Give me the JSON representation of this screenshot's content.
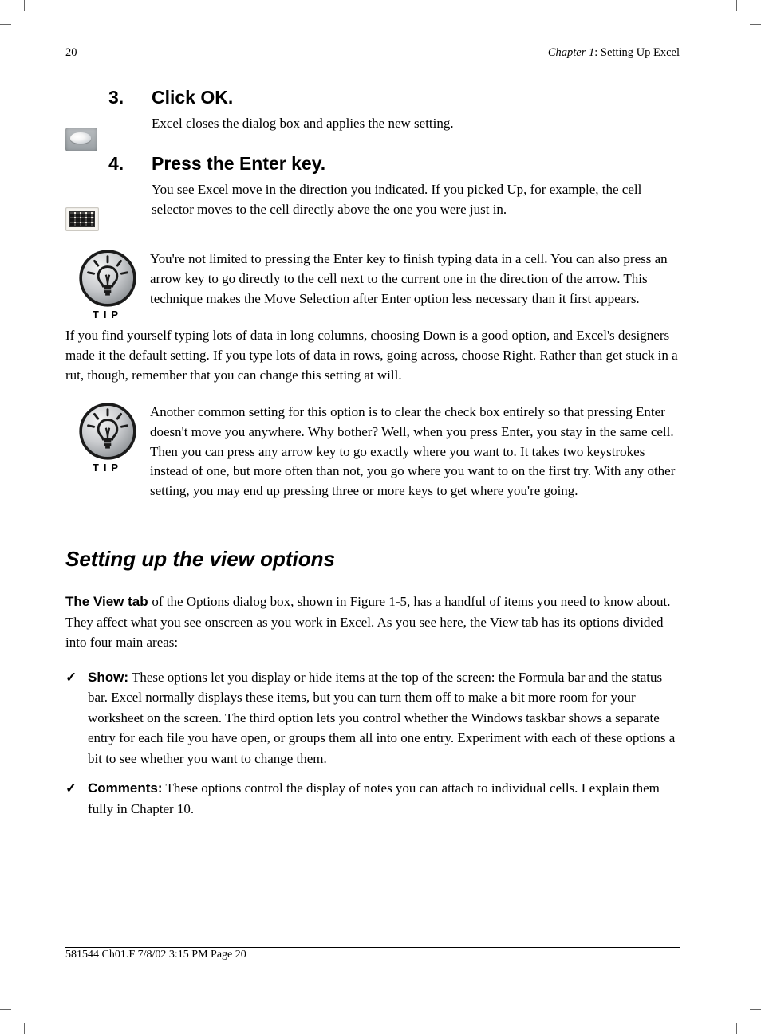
{
  "header": {
    "left": "20",
    "chapter": "Chapter 1",
    "chapter_title": "Setting Up Excel"
  },
  "steps": [
    {
      "num": "3.",
      "title": "Click OK.",
      "text": "Excel closes the dialog box and applies the new setting."
    },
    {
      "num": "4.",
      "title": "Press the Enter key.",
      "text": "You see Excel move in the direction you indicated. If you picked Up, for example, the cell selector moves to the cell directly above the one you were just in."
    }
  ],
  "tips": [
    {
      "label": "TIP",
      "paragraphs": [
        "You're not limited to pressing the Enter key to finish typing data in a cell. You can also press an arrow key to go directly to the cell next to the current one in the direction of the arrow. This technique makes the Move Selection after Enter option less necessary than it first appears."
      ]
    },
    {
      "label": "TIP",
      "paragraphs": [
        "Another common setting for this option is to clear the check box entirely so that pressing Enter doesn't move you anywhere. Why bother? Well, when you press Enter, you stay in the same cell. Then you can press any arrow key to go exactly where you want to. It takes two keystrokes instead of one, but more often than not, you go where you want to on the first try. With any other setting, you may end up pressing three or more keys to get where you're going."
      ]
    }
  ],
  "standalone_para": "If you find yourself typing lots of data in long columns, choosing Down is a good option, and Excel's designers made it the default setting. If you type lots of data in rows, going across, choose Right. Rather than get stuck in a rut, though, remember that you can change this setting at will.",
  "section": {
    "heading": "Setting up the view options",
    "intro_lead": "The View tab ",
    "intro_rest": "of the Options dialog box, shown in Figure 1-5, has a handful of items you need to know about. They affect what you see onscreen as you work in Excel. As you see here, the View tab has its options divided into four main areas:",
    "bullets": [
      {
        "bold": "Show:",
        "rest": " These options let you display or hide items at the top of the screen: the Formula bar and the status bar. Excel normally displays these items, but you can turn them off to make a bit more room for your worksheet on the screen. The third option lets you control whether the Windows taskbar shows a separate entry for each file you have open, or groups them all into one entry. Experiment with each of these options a bit to see whether you want to change them."
      },
      {
        "bold": "Comments:",
        "rest": " These options control the display of notes you can attach to individual cells. I explain them fully in Chapter 10."
      }
    ]
  },
  "footer": "581544 Ch01.F  7/8/02  3:15 PM  Page 20"
}
